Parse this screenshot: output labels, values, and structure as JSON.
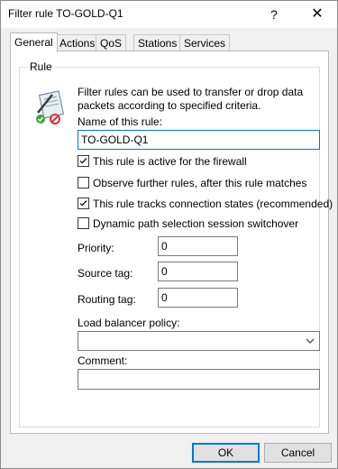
{
  "window": {
    "title": "Filter rule TO-GOLD-Q1",
    "help_glyph": "?",
    "close_glyph": "✕"
  },
  "tabs": [
    {
      "label": "General",
      "selected": true
    },
    {
      "label": "Actions",
      "selected": false
    },
    {
      "label": "QoS",
      "selected": false
    },
    {
      "label": "Stations",
      "selected": false
    },
    {
      "label": "Services",
      "selected": false
    }
  ],
  "rule_group": {
    "label": "Rule",
    "description": "Filter rules can be used to transfer or drop data packets according to specified criteria.",
    "icon": "filter-rule-icon"
  },
  "name": {
    "label": "Name of this rule:",
    "value": "TO-GOLD-Q1"
  },
  "checkboxes": [
    {
      "label": "This rule is active for the firewall",
      "checked": true
    },
    {
      "label": "Observe further rules, after this rule matches",
      "checked": false
    },
    {
      "label": "This rule tracks connection states (recommended)",
      "checked": true
    },
    {
      "label": "Dynamic path selection session switchover",
      "checked": false
    }
  ],
  "priority": {
    "label": "Priority:",
    "value": "0"
  },
  "source_tag": {
    "label": "Source tag:",
    "value": "0"
  },
  "routing_tag": {
    "label": "Routing tag:",
    "value": "0"
  },
  "load_balancer": {
    "label": "Load balancer policy:",
    "value": ""
  },
  "comment": {
    "label": "Comment:",
    "value": ""
  },
  "buttons": {
    "ok": "OK",
    "cancel": "Cancel"
  },
  "colors": {
    "accent": "#0078d7",
    "check": "#000000"
  }
}
